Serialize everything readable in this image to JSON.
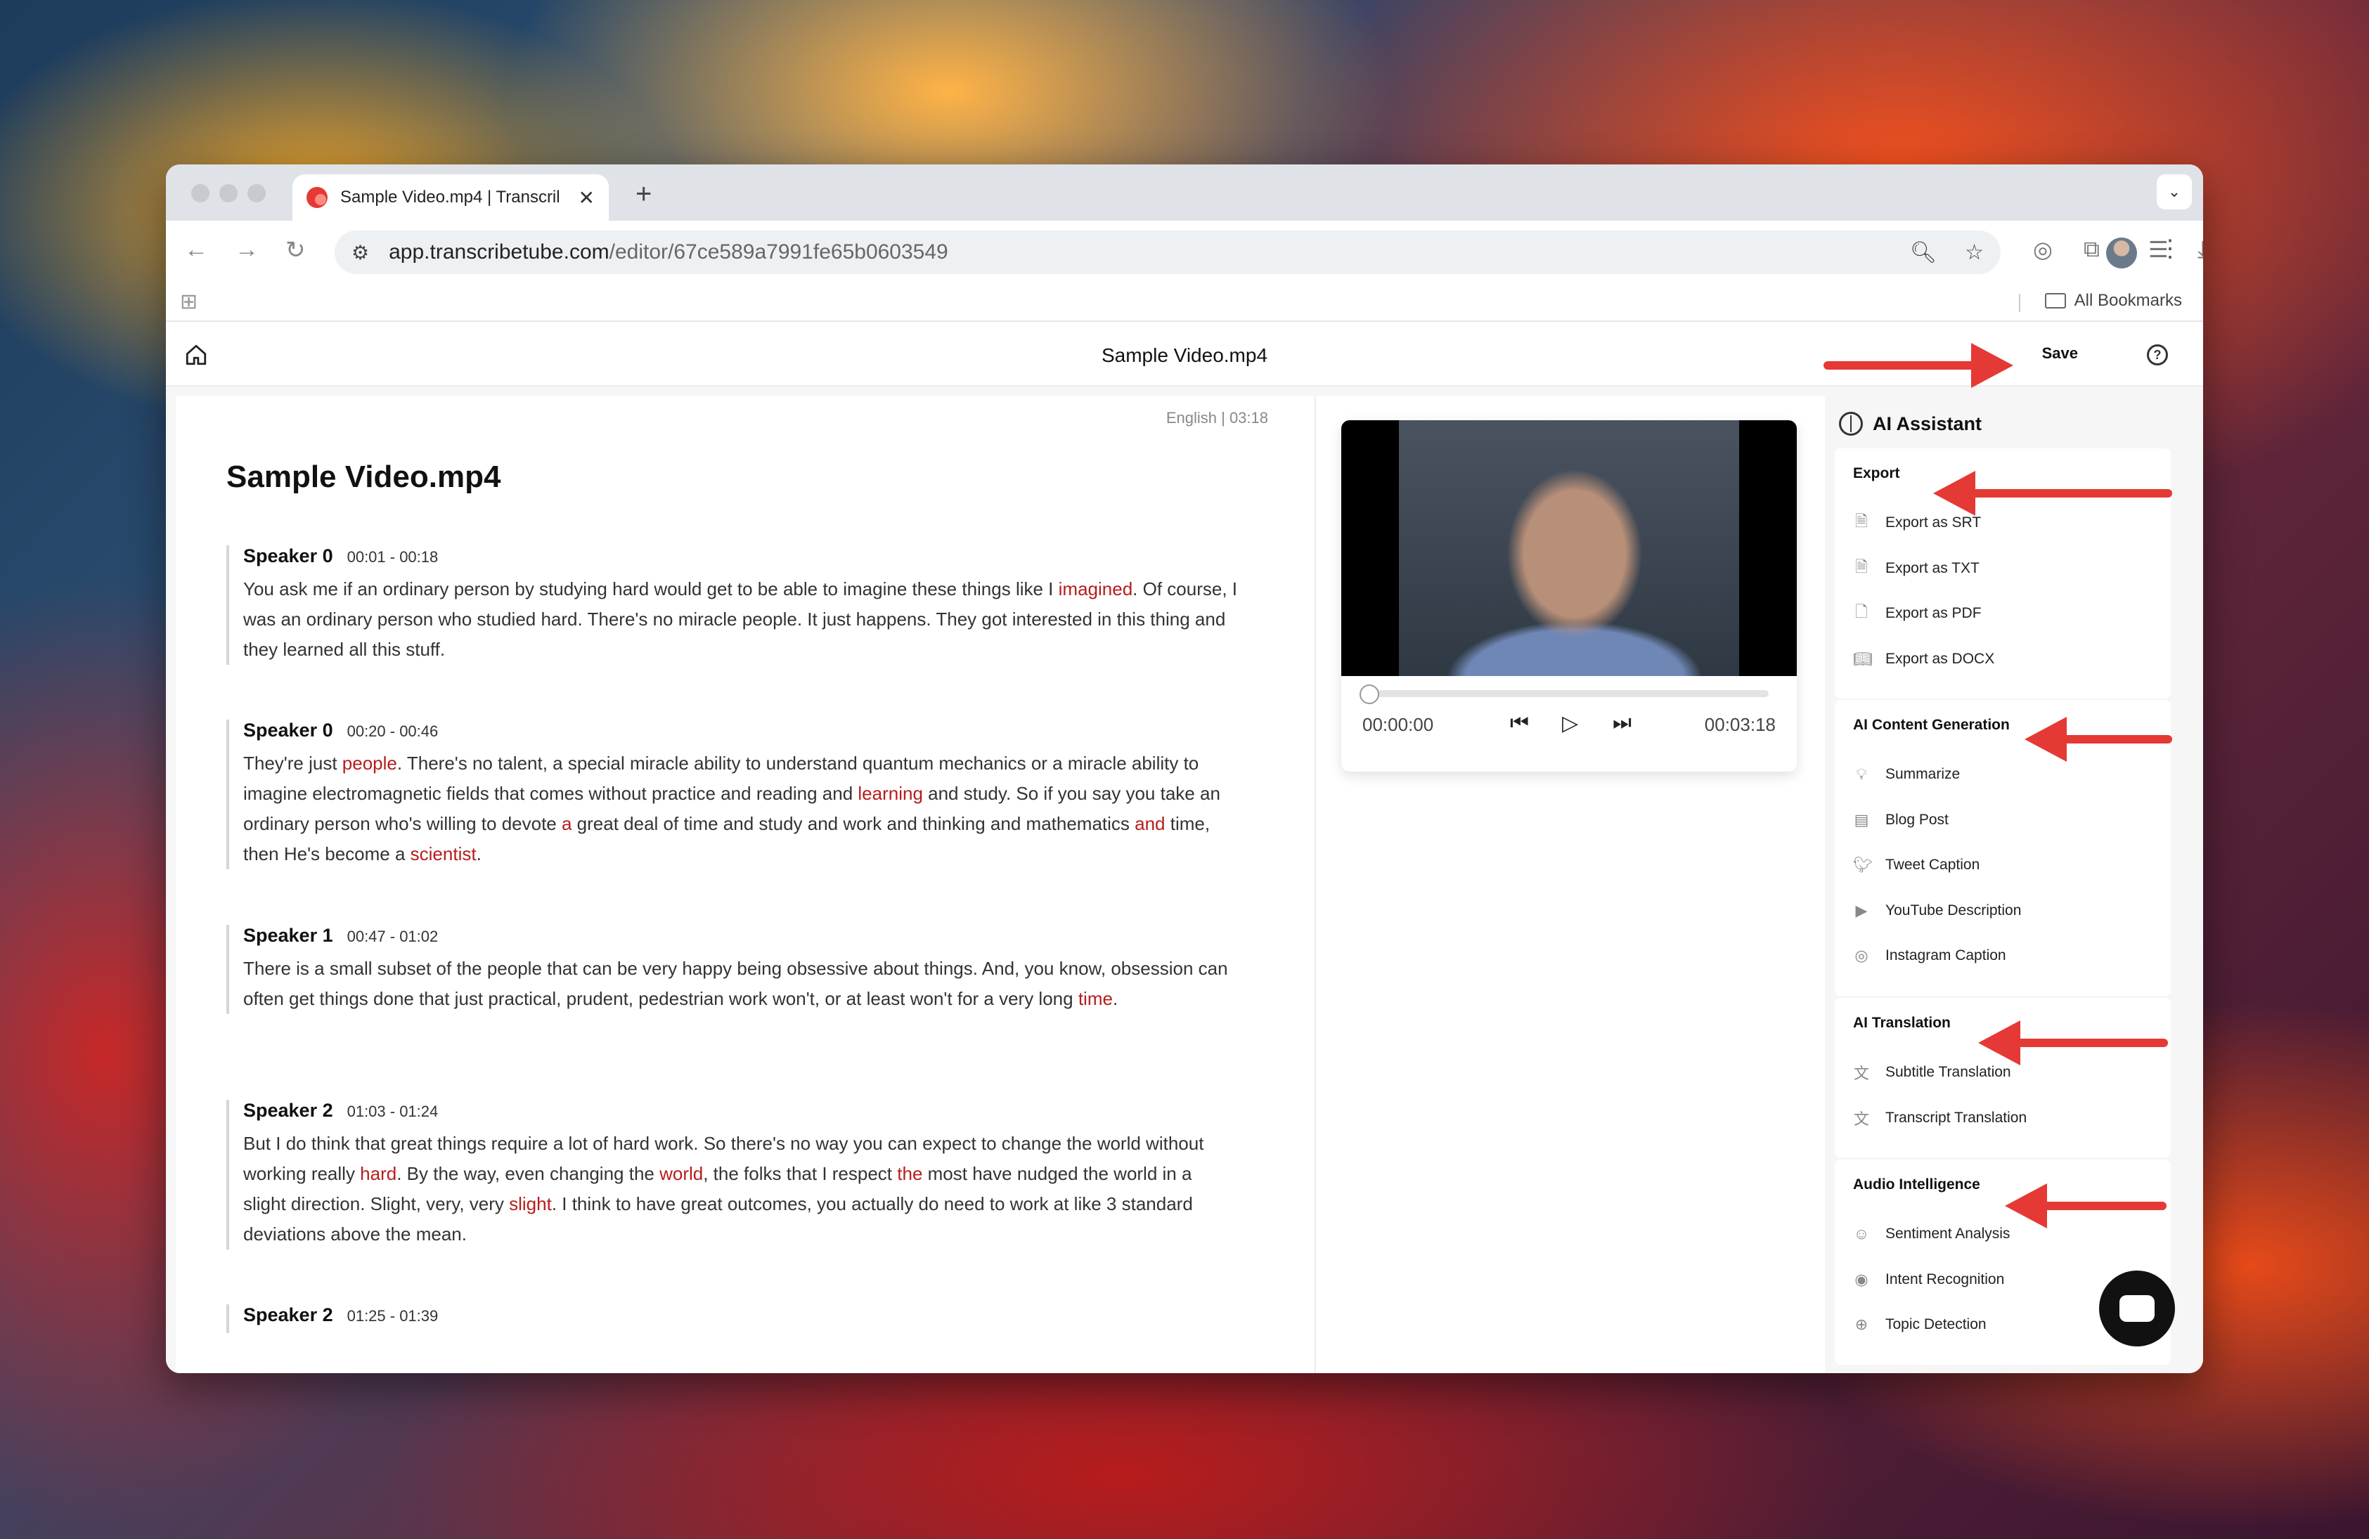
{
  "browser": {
    "tab_title": "Sample Video.mp4 | Transcril",
    "url_host": "app.transcribetube.com",
    "url_path": "/editor/67ce589a7991fe65b0603549",
    "bookmarks_label": "All Bookmarks"
  },
  "app": {
    "title": "Sample Video.mp4",
    "save_label": "Save",
    "help_label": "?"
  },
  "transcript": {
    "meta": "English | 03:18",
    "heading": "Sample Video.mp4",
    "segments": [
      {
        "speaker": "Speaker 0",
        "time": "00:01 - 00:18",
        "parts": [
          "You ask me if an ordinary person by studying hard would get to be able to imagine these things like I ",
          "imagined",
          ". Of course, I was an ordinary person who studied hard. There's no miracle people. It just happens. They got interested in this thing and they learned all this stuff."
        ]
      },
      {
        "speaker": "Speaker 0",
        "time": "00:20 - 00:46",
        "parts": [
          "They're just ",
          "people",
          ". There's no talent, a special miracle ability to understand quantum mechanics or a miracle ability to imagine electromagnetic fields that comes without practice and reading and ",
          "learning",
          " and study. So if you say you take an ordinary person who's willing to devote ",
          "a",
          " great deal of time and study and work and thinking and mathematics ",
          "and",
          " time, then He's become a ",
          "scientist",
          "."
        ]
      },
      {
        "speaker": "Speaker 1",
        "time": "00:47 - 01:02",
        "parts": [
          "There is a small subset of the people that can be very happy being obsessive about things. And, you know, obsession can often get things done that just practical, prudent, pedestrian work won't, or at least won't for a very long ",
          "time",
          "."
        ]
      },
      {
        "speaker": "Speaker 2",
        "time": "01:03 - 01:24",
        "parts": [
          "But I do think that great things require a lot of hard work. So there's no way you can expect to change the world without working really ",
          "hard",
          ". By the way, even changing the ",
          "world",
          ", the folks that I respect ",
          "the",
          " most have nudged the world in a slight direction. Slight, very, very ",
          "slight",
          ". I think to have great outcomes, you actually do need to work at like 3 standard deviations above the mean."
        ]
      },
      {
        "speaker": "Speaker 2",
        "time": "01:25 - 01:39",
        "parts": [
          ""
        ]
      }
    ]
  },
  "player": {
    "current_time": "00:00:00",
    "total_time": "00:03:18",
    "progress": 0
  },
  "ai_assistant": {
    "title": "AI Assistant",
    "export": {
      "title": "Export",
      "items": [
        "Export as SRT",
        "Export as TXT",
        "Export as PDF",
        "Export as DOCX"
      ]
    },
    "content_generation": {
      "title": "AI Content Generation",
      "items": [
        "Summarize",
        "Blog Post",
        "Tweet Caption",
        "YouTube Description",
        "Instagram Caption"
      ]
    },
    "translation": {
      "title": "AI Translation",
      "items": [
        "Subtitle Translation",
        "Transcript Translation"
      ]
    },
    "audio_intelligence": {
      "title": "Audio Intelligence",
      "items": [
        "Sentiment Analysis",
        "Intent Recognition",
        "Topic Detection"
      ]
    }
  },
  "colors": {
    "highlight": "#b71c1c",
    "annotation_arrow": "#e53935"
  }
}
